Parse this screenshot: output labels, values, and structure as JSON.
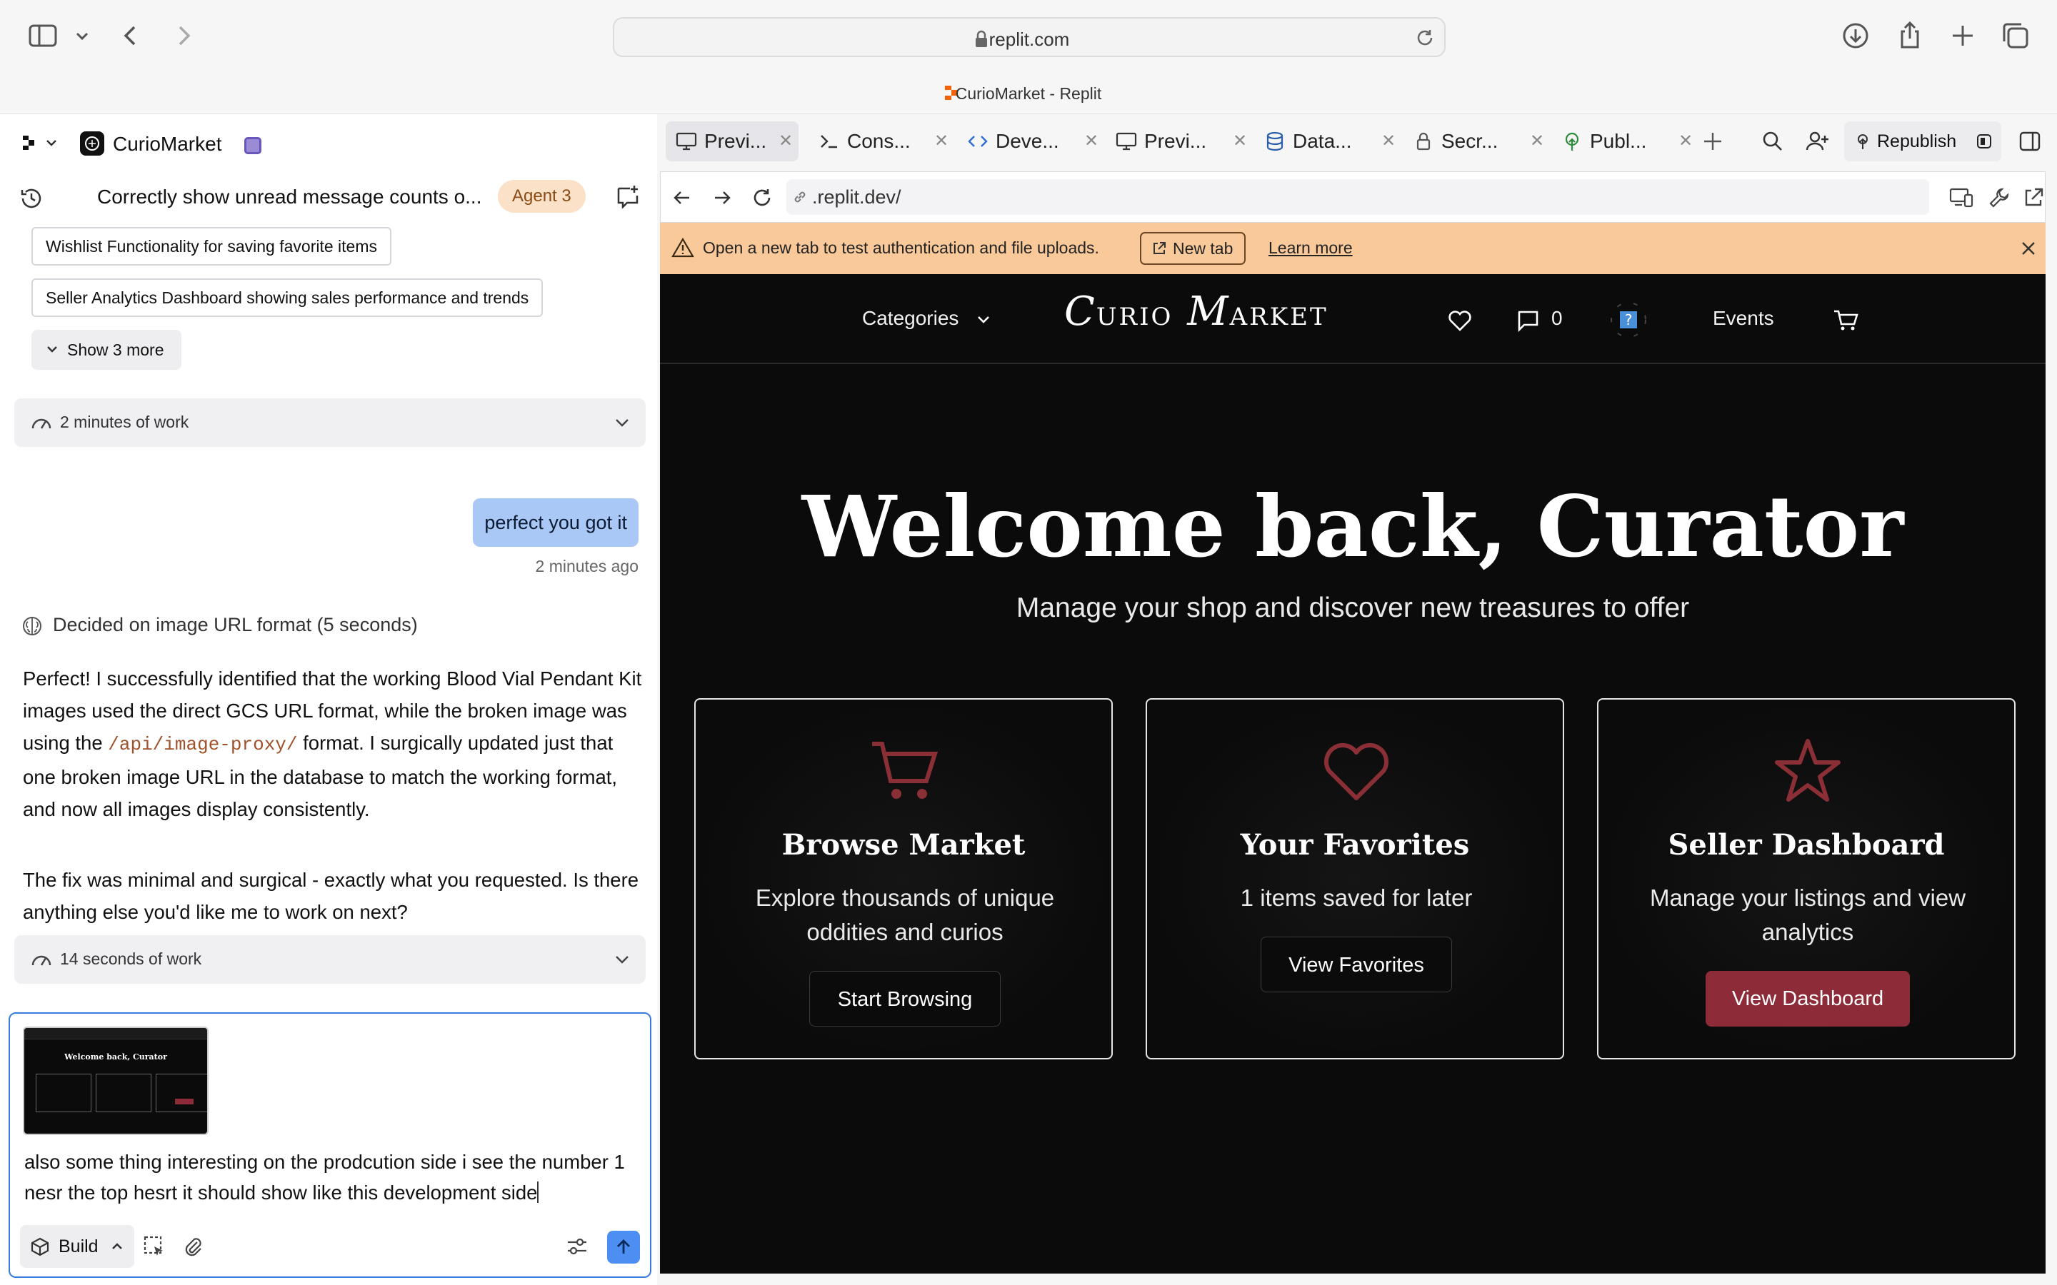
{
  "browser": {
    "url": "replit.com",
    "tab_title": "CurioMarket - Replit"
  },
  "project": {
    "name": "CurioMarket"
  },
  "thread": {
    "title": "Correctly show unread message counts o...",
    "agent_badge": "Agent 3"
  },
  "suggestions": [
    "Wishlist Functionality for saving favorite items",
    "Seller Analytics Dashboard showing sales performance and trends"
  ],
  "show_more": "Show 3 more",
  "work_bars": [
    "2 minutes of work",
    "14 seconds of work"
  ],
  "user_message": {
    "text": "perfect you got it",
    "time": "2 minutes ago"
  },
  "decided": "Decided on image URL format (5 seconds)",
  "response": {
    "p1_a": "Perfect! I successfully identified that the working Blood Vial Pendant Kit images used the direct GCS URL format, while the broken image was using the ",
    "p1_code": "/api/image-proxy/",
    "p1_b": " format. I surgically updated just that one broken image URL in the database to match the working format, and now all images display consistently.",
    "p2": "The fix was minimal and surgical - exactly what you requested. Is there anything else you'd like me to work on next?"
  },
  "input": {
    "text": "also some thing interesting on the prodcution side i see the number 1 nesr the top hesrt it should show like this development side",
    "build_label": "Build",
    "thumb_title": "Welcome back, Curator"
  },
  "workspace_tabs": [
    "Previ...",
    "Cons...",
    "Deve...",
    "Previ...",
    "Data...",
    "Secr...",
    "Publ..."
  ],
  "republish": "Republish",
  "preview": {
    "address": ".replit.dev/",
    "notice": "Open a new tab to test authentication and file uploads.",
    "new_tab": "New tab",
    "learn_more": "Learn more"
  },
  "app": {
    "nav": {
      "categories": "Categories",
      "logo_c": "C",
      "logo_urio": "URIO",
      "logo_m": "M",
      "logo_arket": "ARKET",
      "message_count": "0",
      "events": "Events"
    },
    "hero_title": "Welcome back, Curator",
    "hero_subtitle": "Manage your shop and discover new treasures to offer",
    "cards": [
      {
        "title": "Browse Market",
        "desc": "Explore thousands of unique oddities and curios",
        "button": "Start Browsing",
        "icon": "cart-icon"
      },
      {
        "title": "Your Favorites",
        "desc": "1 items saved for later",
        "button": "View Favorites",
        "icon": "heart-icon"
      },
      {
        "title": "Seller Dashboard",
        "desc": "Manage your listings and view analytics",
        "button": "View Dashboard",
        "icon": "star-icon"
      }
    ]
  },
  "colors": {
    "accent_red": "#8d2b38",
    "icon_red": "#8a2f35",
    "notice_bg": "#f9c99a",
    "user_bubble": "#a9c8f5",
    "send_blue": "#4d8ef2"
  }
}
